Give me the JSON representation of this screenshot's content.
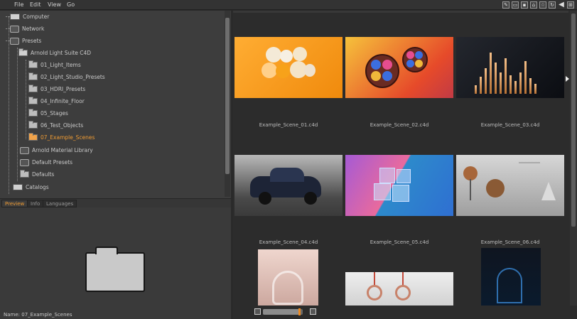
{
  "menu": {
    "items": [
      "File",
      "Edit",
      "View",
      "Go"
    ]
  },
  "toolbar": {
    "icons": [
      "pencil-icon",
      "window-icon",
      "lock-icon",
      "home-icon",
      "star-icon",
      "sync-icon",
      "back-arrow-icon",
      "grid-icon"
    ]
  },
  "tree": {
    "items": [
      {
        "label": "Computer",
        "icon": "computer-icon"
      },
      {
        "label": "Network",
        "icon": "network-icon"
      },
      {
        "label": "Presets",
        "icon": "presets-icon"
      },
      {
        "label": "Arnold Light Suite C4D",
        "icon": "folder-open-icon"
      },
      {
        "label": "01_Light_Items",
        "icon": "folder-icon"
      },
      {
        "label": "02_Light_Studio_Presets",
        "icon": "folder-icon"
      },
      {
        "label": "03_HDRI_Presets",
        "icon": "folder-icon"
      },
      {
        "label": "04_Infinite_Floor",
        "icon": "folder-icon"
      },
      {
        "label": "05_Stages",
        "icon": "folder-icon"
      },
      {
        "label": "06_Test_Objects",
        "icon": "folder-icon"
      },
      {
        "label": "07_Example_Scenes",
        "icon": "folder-icon",
        "selected": true
      },
      {
        "label": "Arnold Material Library",
        "icon": "library-icon"
      },
      {
        "label": "Default Presets",
        "icon": "library-icon"
      },
      {
        "label": "Defaults",
        "icon": "folder-icon"
      },
      {
        "label": "Catalogs",
        "icon": "catalog-icon"
      }
    ]
  },
  "tabs": {
    "preview": "Preview",
    "info": "Info",
    "languages": "Languages",
    "active": "Preview"
  },
  "preview": {
    "name_line": "Name: 07_Example_Scenes"
  },
  "grid": {
    "items": [
      {
        "label": "Example_Scene_01.c4d"
      },
      {
        "label": "Example_Scene_02.c4d"
      },
      {
        "label": "Example_Scene_03.c4d"
      },
      {
        "label": "Example_Scene_04.c4d"
      },
      {
        "label": "Example_Scene_05.c4d"
      },
      {
        "label": "Example_Scene_06.c4d"
      },
      {
        "label": ""
      },
      {
        "label": ""
      },
      {
        "label": ""
      }
    ]
  },
  "zoom": {
    "fraction": 0.95
  },
  "colors": {
    "accent": "#ef9b33",
    "panel": "#3d3d3d",
    "browser_bg": "#2c2c2c"
  }
}
